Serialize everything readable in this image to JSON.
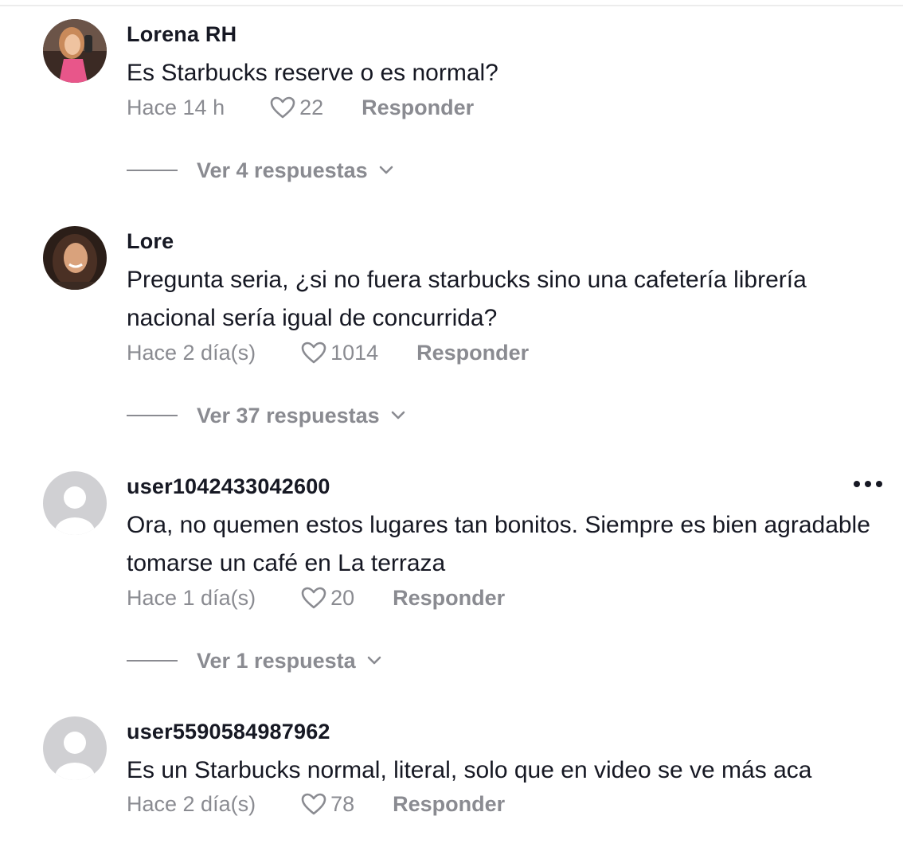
{
  "comments": [
    {
      "username": "Lorena RH",
      "text": "Es Starbucks reserve o es normal?",
      "time": "Hace 14 h",
      "likes": "22",
      "reply_label": "Responder",
      "view_replies": "Ver 4 respuestas",
      "avatar": "photo"
    },
    {
      "username": "Lore",
      "text": "Pregunta seria, ¿si no fuera starbucks sino una cafetería librería nacional sería igual de concurrida?",
      "time": "Hace 2 día(s)",
      "likes": "1014",
      "reply_label": "Responder",
      "view_replies": "Ver 37 respuestas",
      "avatar": "photo"
    },
    {
      "username": "user1042433042600",
      "text": "Ora, no quemen estos lugares tan bonitos. Siempre es bien agradable tomarse un café en La terraza",
      "time": "Hace 1 día(s)",
      "likes": "20",
      "reply_label": "Responder",
      "view_replies": "Ver 1 respuesta",
      "avatar": "default"
    },
    {
      "username": "user5590584987962",
      "text": "Es un Starbucks normal, literal, solo que en video se ve más aca",
      "time": "Hace 2 día(s)",
      "likes": "78",
      "reply_label": "Responder",
      "avatar": "default"
    }
  ],
  "icons": {
    "like": "heart-outline-icon",
    "expand": "chevron-down-icon",
    "more": "more-horizontal-icon"
  },
  "colors": {
    "primary_text": "#161823",
    "secondary_text": "#8a8b91",
    "default_avatar_bg": "#d0d0d3"
  }
}
